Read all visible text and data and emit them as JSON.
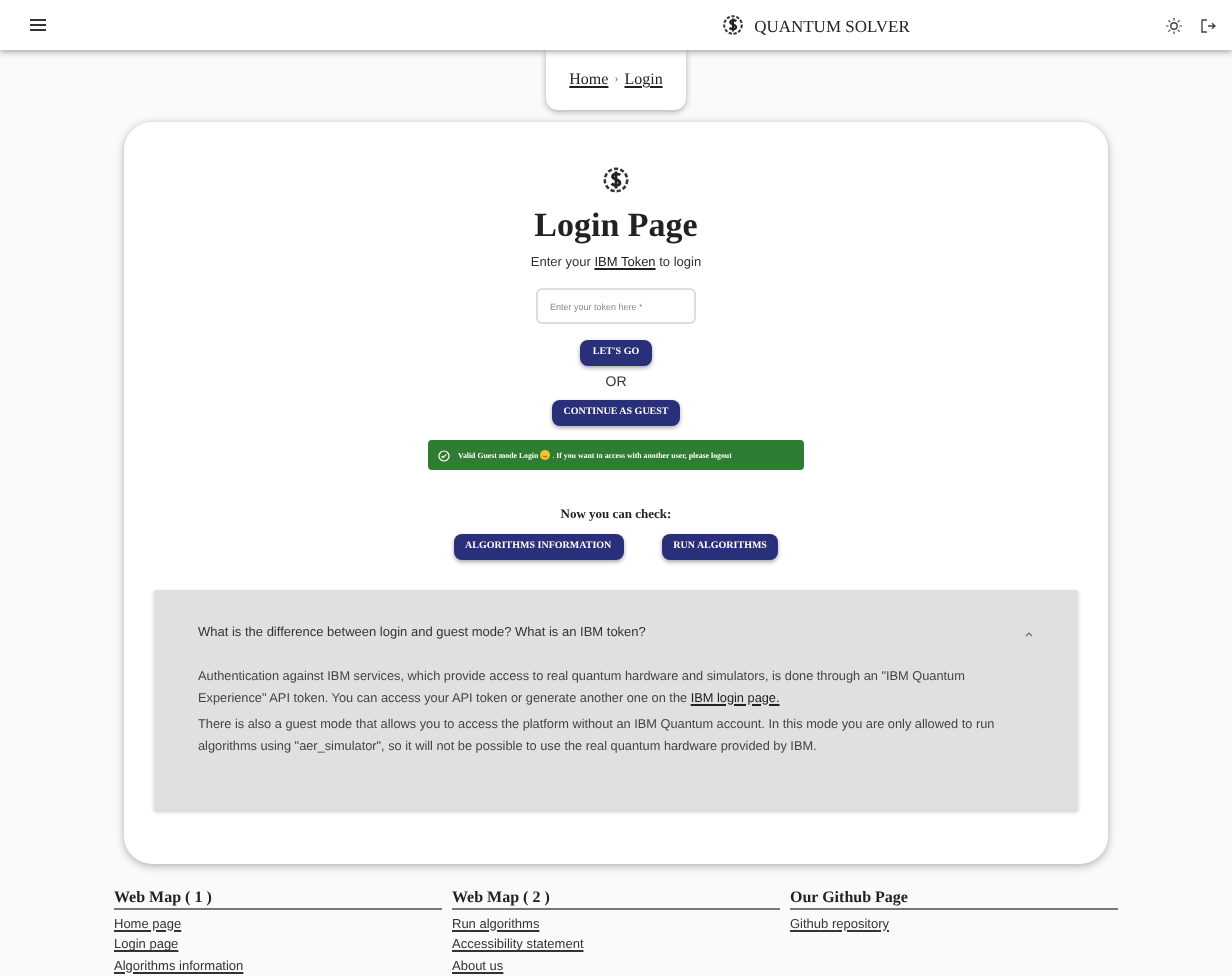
{
  "header": {
    "title": "QUANTUM SOLVER"
  },
  "breadcrumb": {
    "separator": "›",
    "items": [
      {
        "label": "Home"
      },
      {
        "label": "Login"
      }
    ]
  },
  "login": {
    "title": "Login Page",
    "intro": {
      "before": "Enter your ",
      "link": "IBM Token",
      "after": " to login"
    },
    "token_field": {
      "placeholder": "Enter your token here *"
    },
    "submit": "LET'S GO",
    "or": "OR",
    "guest": "CONTINUE AS GUEST",
    "alert": {
      "kind": "success",
      "before": "Valid Guest mode Login",
      "after": ". If you want to access with another user, please logout"
    },
    "check_title": "Now you can check:",
    "check_buttons": [
      "ALGORITHMS INFORMATION",
      "RUN ALGORITHMS"
    ]
  },
  "faq": {
    "question": "What is the difference between login and guest mode? What is an IBM token?",
    "expanded": true,
    "answer_1": {
      "before": "Authentication against IBM services, which provide access to real quantum hardware and simulators, is done through an \"IBM Quantum Experience\" API token. You can access your API token or generate another one on the ",
      "link": "IBM login page."
    },
    "answer_2": "There is also a guest mode that allows you to access the platform without an IBM Quantum account. In this mode you are only allowed to run algorithms using \"aer_simulator\", so it will not be possible to use the real quantum hardware provided by IBM."
  },
  "footer": [
    {
      "title": "Web Map ( 1 )",
      "links": [
        "Home page",
        "Login page",
        "Algorithms information"
      ]
    },
    {
      "title": "Web Map ( 2 )",
      "links": [
        "Run algorithms",
        "Accessibility statement",
        "About us"
      ]
    },
    {
      "title": "Our Github Page",
      "links": [
        "Github repository"
      ]
    }
  ]
}
